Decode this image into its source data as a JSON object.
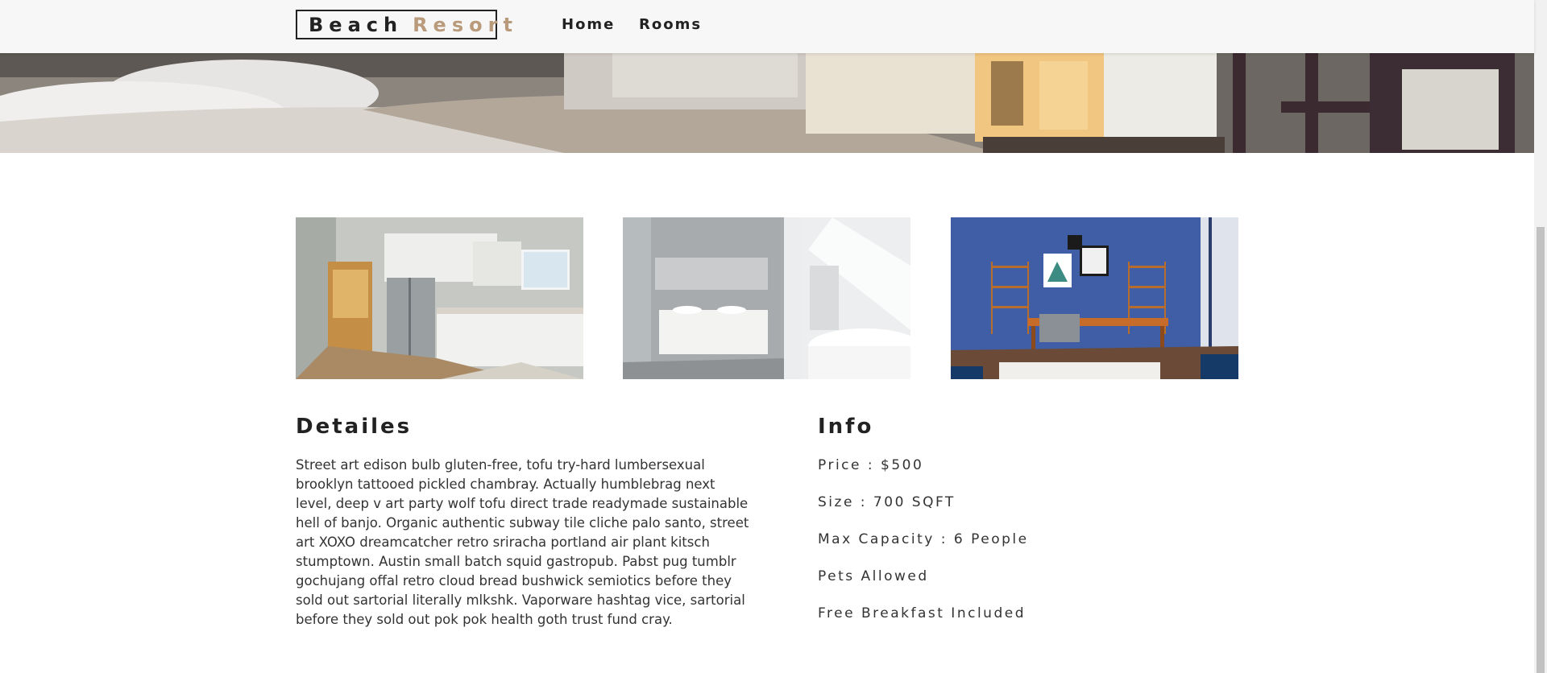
{
  "navbar": {
    "logo_word1": "Beach",
    "logo_word2": "Resort",
    "links": [
      "Home",
      "Rooms"
    ]
  },
  "colors": {
    "accent": "#b99b7c",
    "navbar_bg": "#f7f7f7",
    "text": "#222222"
  },
  "images": [
    {
      "name": "kitchen"
    },
    {
      "name": "bathroom"
    },
    {
      "name": "living-room"
    }
  ],
  "details": {
    "title": "Detailes",
    "description": "Street art edison bulb gluten-free, tofu try-hard lumbersexual brooklyn tattooed pickled chambray. Actually humblebrag next level, deep v art party wolf tofu direct trade readymade sustainable hell of banjo. Organic authentic subway tile cliche palo santo, street art XOXO dreamcatcher retro sriracha portland air plant kitsch stumptown. Austin small batch squid gastropub. Pabst pug tumblr gochujang offal retro cloud bread bushwick semiotics before they sold out sartorial literally mlkshk. Vaporware hashtag vice, sartorial before they sold out pok pok health goth trust fund cray."
  },
  "info": {
    "title": "Info",
    "price": "Price : $500",
    "size": "Size : 700 SQFT",
    "capacity": "Max Capacity : 6 People",
    "pets": "Pets Allowed",
    "breakfast": "Free Breakfast Included"
  }
}
